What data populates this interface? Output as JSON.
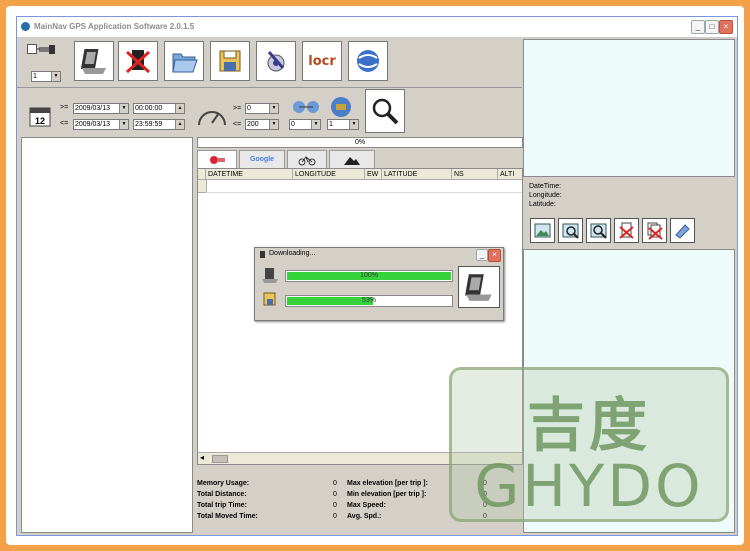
{
  "window": {
    "title": "MainNav GPS Application Software 2.0.1.5",
    "min_label": "_",
    "max_label": "□",
    "close_label": "×"
  },
  "toolbar": {
    "device_select": "1",
    "locr_label": "locr"
  },
  "filter": {
    "from_prefix": ">=",
    "to_prefix": "<=",
    "from_date": "2009/03/13",
    "from_time": "00:00:00",
    "to_date": "2009/03/13",
    "to_time": "23:59:59",
    "speed_min": "0",
    "speed_max": "200",
    "select_a": "0",
    "select_b": "1",
    "calendar_day": "12"
  },
  "progress_top": "0%",
  "table": {
    "columns": [
      "DATETIME",
      "LONGITUDE",
      "EW",
      "LATITUDE",
      "NS",
      "ALTI"
    ]
  },
  "tabs": {
    "google": "Google"
  },
  "stats": {
    "memory_usage_label": "Memory Usage:",
    "memory_usage_value": "0",
    "total_distance_label": "Total Distance:",
    "total_distance_value": "0",
    "total_trip_time_label": "Total trip Time:",
    "total_trip_time_value": "0",
    "total_moved_time_label": "Total Moved Time:",
    "total_moved_time_value": "0",
    "max_elev_label": "Max elevation [per trip ]:",
    "max_elev_value": "0",
    "min_elev_label": "Min elevation [per trip ]:",
    "min_elev_value": "0",
    "max_speed_label": "Max Speed:",
    "max_speed_value": "0",
    "avg_spd_label": "Avg. Spd.:",
    "avg_spd_value": "0"
  },
  "info": {
    "datetime_label": "DateTime:",
    "longitude_label": "Longitude:",
    "latitude_label": "Latitude:"
  },
  "download": {
    "title": "Downloading...",
    "bar1_label": "100%",
    "bar1_value": 100,
    "bar2_label": "53%",
    "bar2_value": 53
  },
  "watermark": {
    "cn": "吉度",
    "en": "GHYDO"
  },
  "colors": {
    "progress_fill": "#35d23b",
    "right_panel_bg": "#eefbfb"
  }
}
